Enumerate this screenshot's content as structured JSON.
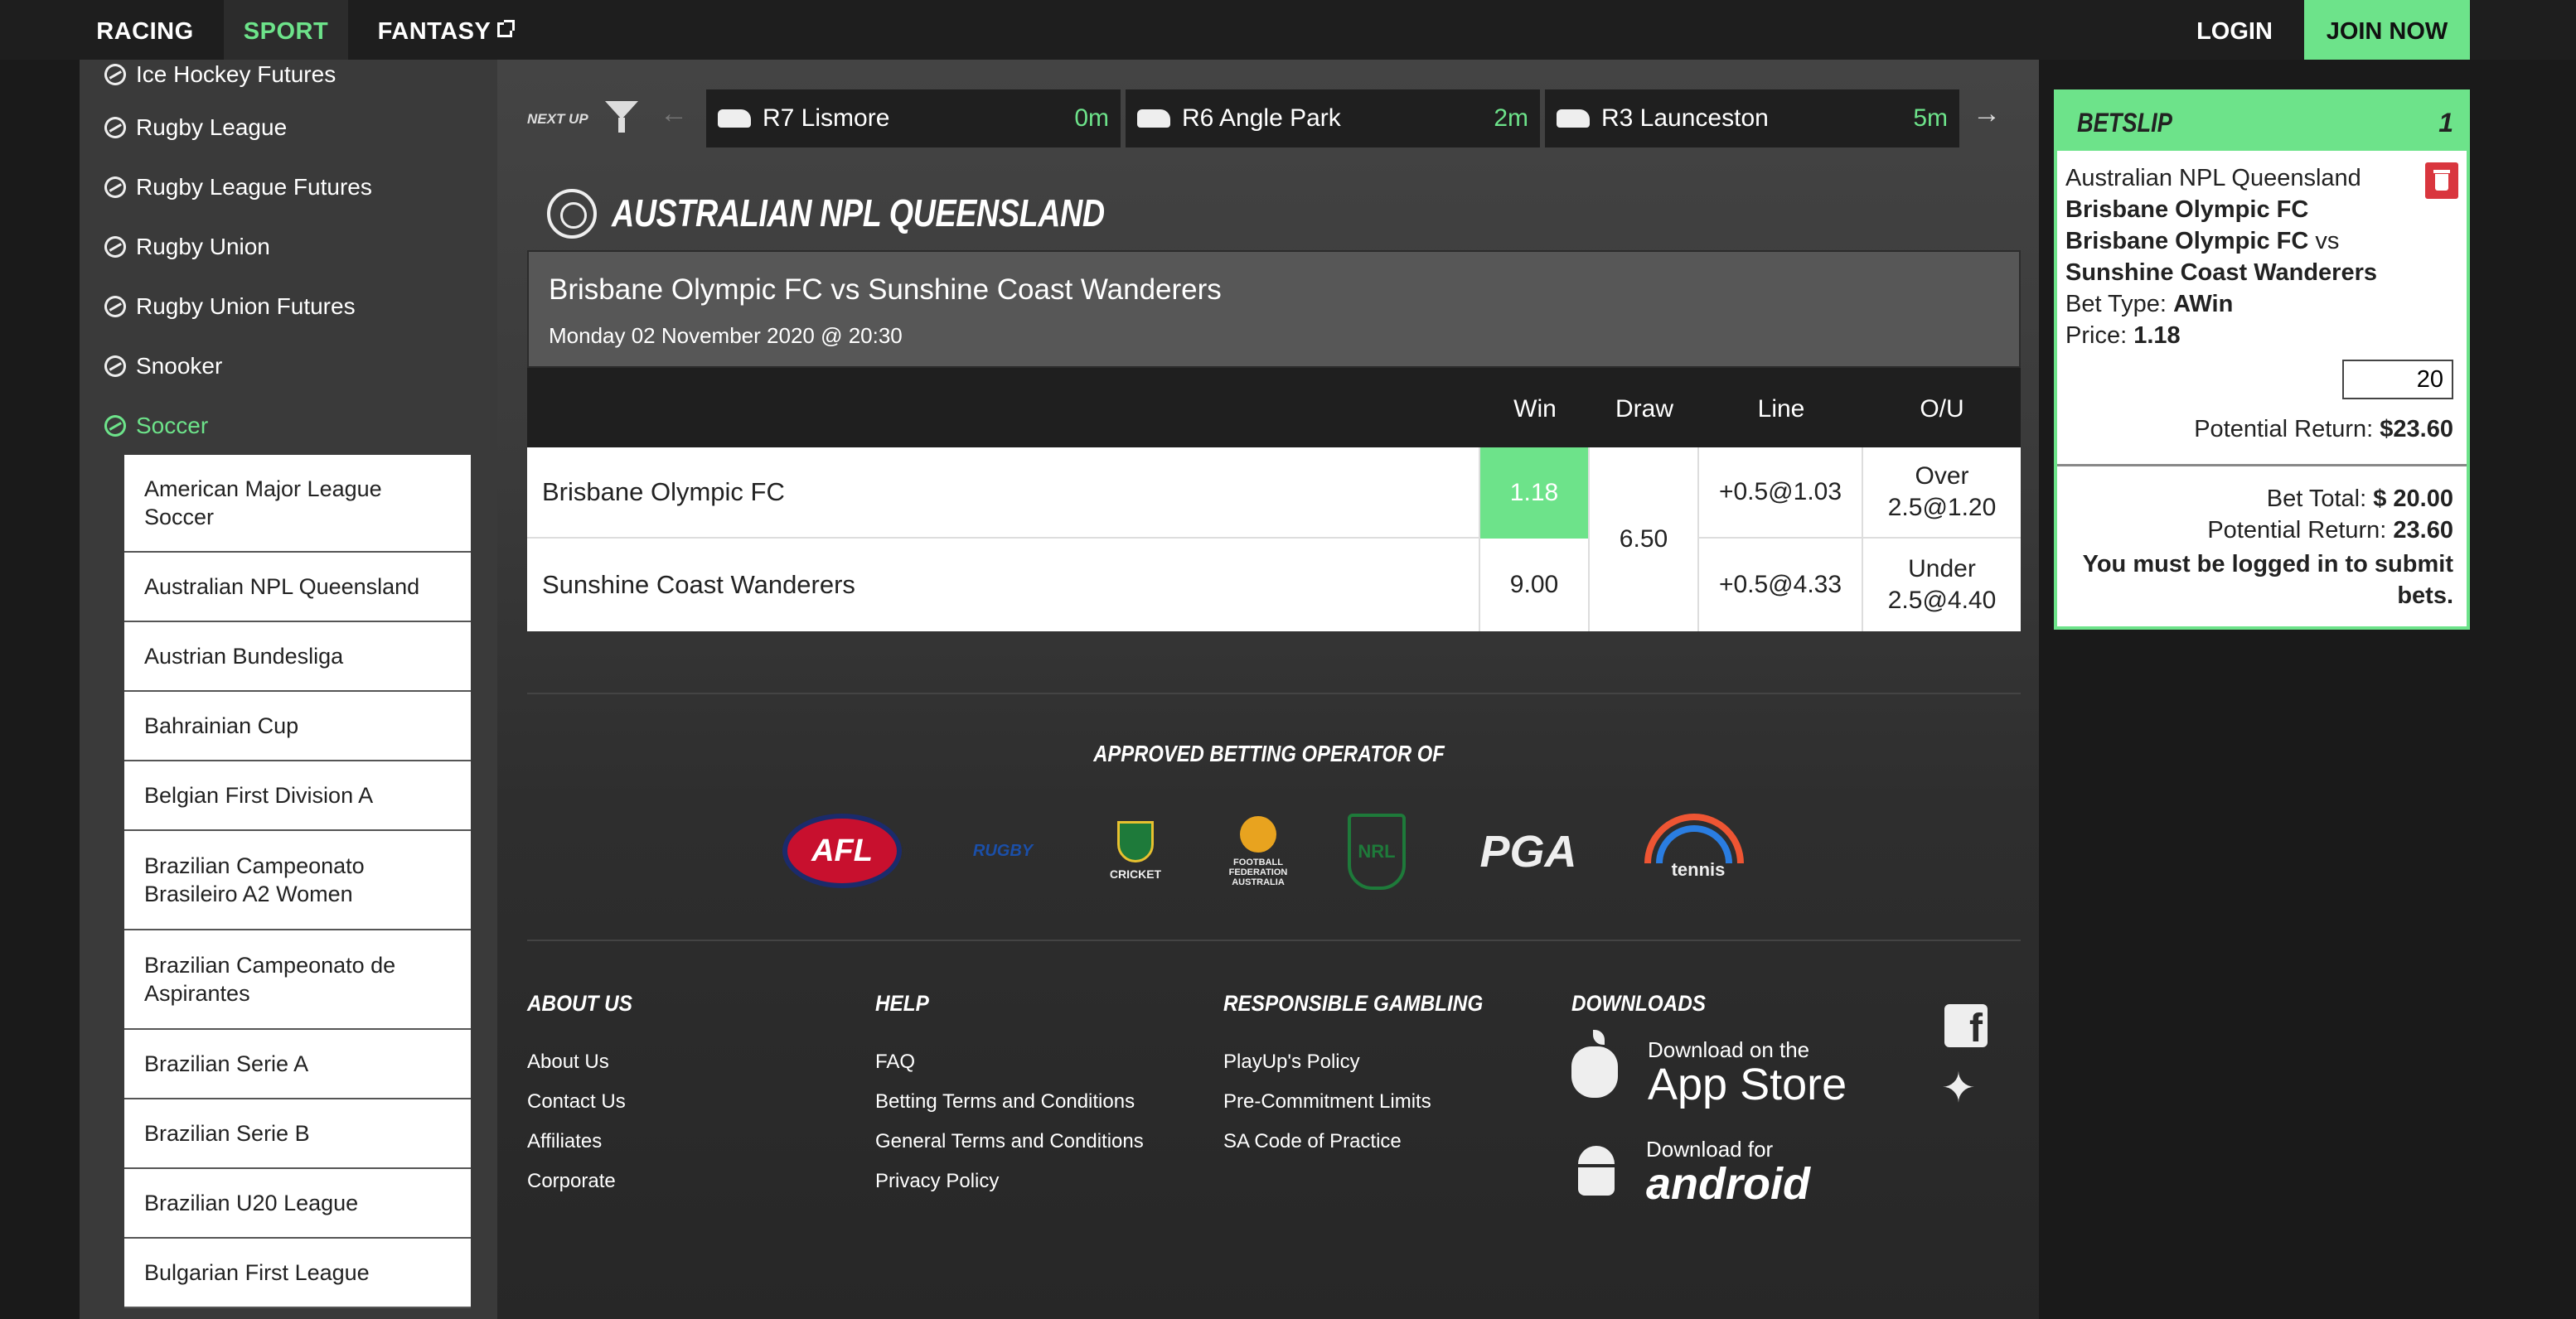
{
  "nav": {
    "racing": "RACING",
    "sport": "SPORT",
    "fantasy": "FANTASY",
    "login": "LOGIN",
    "join": "JOIN NOW"
  },
  "sidebar": {
    "sports": [
      {
        "label": "Ice Hockey Futures",
        "icon": "ice-hockey-icon"
      },
      {
        "label": "Rugby League",
        "icon": "rugby-ball-icon"
      },
      {
        "label": "Rugby League Futures",
        "icon": "rugby-ball-icon"
      },
      {
        "label": "Rugby Union",
        "icon": "rugby-ball-icon"
      },
      {
        "label": "Rugby Union Futures",
        "icon": "rugby-ball-icon"
      },
      {
        "label": "Snooker",
        "icon": "snooker-icon"
      },
      {
        "label": "Soccer",
        "icon": "soccer-ball-icon",
        "active": true
      }
    ],
    "competitions": [
      "American Major League Soccer",
      "Australian NPL Queensland",
      "Austrian Bundesliga",
      "Bahrainian Cup",
      "Belgian First Division A",
      "Brazilian Campeonato Brasileiro A2 Women",
      "Brazilian Campeonato de Aspirantes",
      "Brazilian Serie A",
      "Brazilian Serie B",
      "Brazilian U20 League",
      "Bulgarian First League"
    ]
  },
  "next_up": {
    "label": "NEXT UP",
    "races": [
      {
        "name": "R7 Lismore",
        "time": "0m"
      },
      {
        "name": "R6 Angle Park",
        "time": "2m"
      },
      {
        "name": "R3 Launceston",
        "time": "5m"
      }
    ]
  },
  "event": {
    "competition_title": "AUSTRALIAN NPL QUEENSLAND",
    "match": "Brisbane Olympic FC vs Sunshine Coast Wanderers",
    "date": "Monday 02 November 2020 @ 20:30",
    "columns": [
      "Win",
      "Draw",
      "Line",
      "O/U"
    ],
    "draw": "6.50",
    "rows": [
      {
        "team": "Brisbane Olympic FC",
        "win": "1.18",
        "line": "+0.5@1.03",
        "ou": "Over 2.5@1.20"
      },
      {
        "team": "Sunshine Coast Wanderers",
        "win": "9.00",
        "line": "+0.5@4.33",
        "ou": "Under 2.5@4.40"
      }
    ]
  },
  "approved": {
    "heading": "APPROVED BETTING OPERATOR OF",
    "logos": {
      "afl": "AFL",
      "rugby": "RUGBY",
      "cricket": "CRICKET",
      "ffa": "FOOTBALL FEDERATION AUSTRALIA",
      "nrl": "NRL",
      "pga": "PGA",
      "tennis": "tennis"
    }
  },
  "footer": {
    "about": {
      "heading": "ABOUT US",
      "links": [
        "About Us",
        "Contact Us",
        "Affiliates",
        "Corporate"
      ]
    },
    "help": {
      "heading": "HELP",
      "links": [
        "FAQ",
        "Betting Terms and Conditions",
        "General Terms and Conditions",
        "Privacy Policy"
      ]
    },
    "gambling": {
      "heading": "RESPONSIBLE GAMBLING",
      "links": [
        "PlayUp's Policy",
        "Pre-Commitment Limits",
        "SA Code of Practice"
      ]
    },
    "downloads": {
      "heading": "DOWNLOADS",
      "appstore_small": "Download on the",
      "appstore_big": "App Store",
      "android_small": "Download for",
      "android_big": "android"
    }
  },
  "betslip": {
    "title": "BETSLIP",
    "count": "1",
    "competition": "Australian NPL Queensland",
    "selection": "Brisbane Olympic FC",
    "team_a": "Brisbane Olympic FC",
    "vs": "vs",
    "team_b": "Sunshine Coast Wanderers",
    "bet_type_label": "Bet Type:",
    "bet_type": "AWin",
    "price_label": "Price:",
    "price": "1.18",
    "stake": "20",
    "potential_label": "Potential Return:",
    "potential": "$23.60",
    "total_label": "Bet Total:",
    "total": "$ 20.00",
    "potential2_label": "Potential Return:",
    "potential2": "23.60",
    "warning": "You must be logged in to submit bets."
  },
  "colors": {
    "accent": "#6de38a",
    "delete": "#d9363e"
  }
}
